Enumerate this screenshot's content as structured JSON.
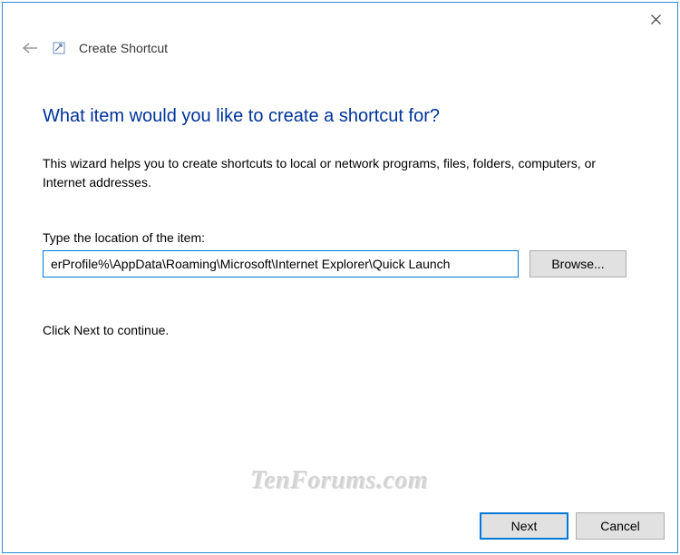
{
  "window": {
    "title": "Create Shortcut"
  },
  "content": {
    "heading": "What item would you like to create a shortcut for?",
    "description": "This wizard helps you to create shortcuts to local or network programs, files, folders, computers, or Internet addresses.",
    "field_label": "Type the location of the item:",
    "path_value": "erProfile%\\AppData\\Roaming\\Microsoft\\Internet Explorer\\Quick Launch",
    "browse_label": "Browse...",
    "continue_text": "Click Next to continue."
  },
  "footer": {
    "next_label": "Next",
    "cancel_label": "Cancel"
  },
  "watermark": "TenForums.com"
}
